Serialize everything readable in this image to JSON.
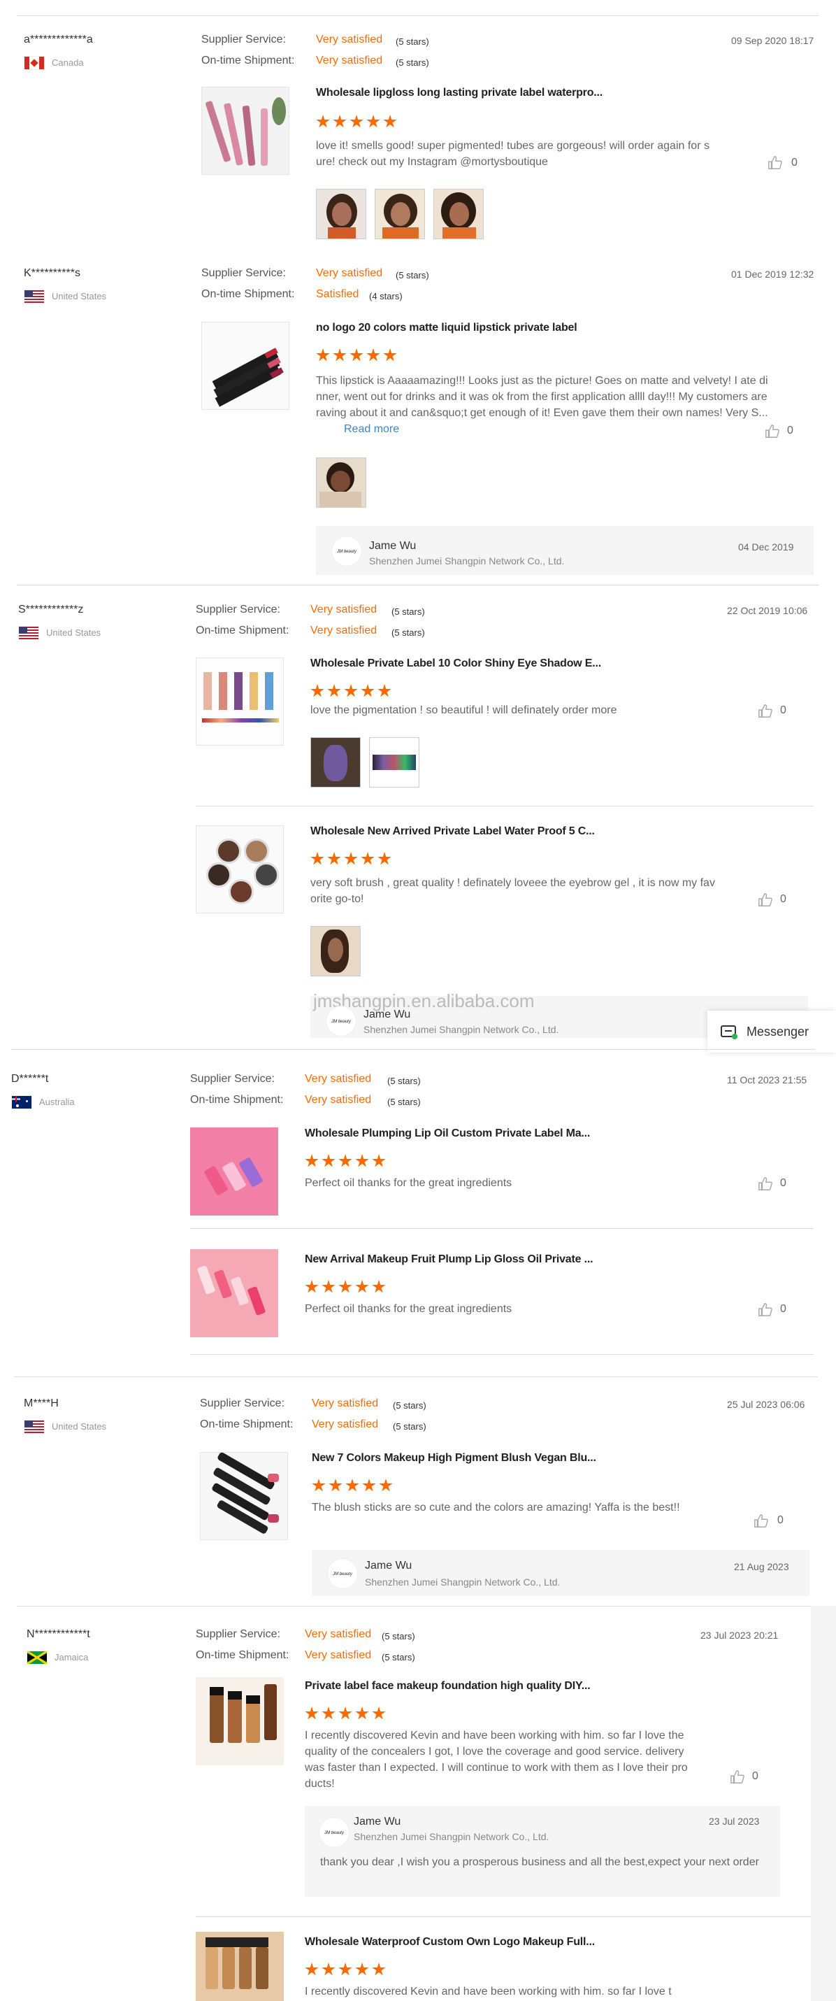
{
  "labels": {
    "supplier_service": "Supplier Service:",
    "on_time_shipment": "On-time Shipment:",
    "read_more": "Read more",
    "messenger": "Messenger",
    "watermark": "jmshangpin.en.alibaba.com"
  },
  "colors": {
    "accent": "#ff6a00",
    "link": "#3d85c6"
  },
  "reviews": [
    {
      "buyer": "a*************a",
      "country": "Canada",
      "flag": "canada",
      "date": "09 Sep 2020 18:17",
      "supplier_service": {
        "rating": "Very satisfied",
        "stars": "(5 stars)"
      },
      "shipment": {
        "rating": "Very satisfied",
        "stars": "(5 stars)"
      },
      "items": [
        {
          "title": "Wholesale lipgloss long lasting private label waterpro...",
          "rating": 5,
          "text": "love it! smells good! super pigmented! tubes are gorgeous! will order again for sure! check out my Instagram @mortysboutique",
          "likes": "0",
          "photos": 3
        }
      ]
    },
    {
      "buyer": "K**********s",
      "country": "United States",
      "flag": "us",
      "date": "01 Dec 2019 12:32",
      "supplier_service": {
        "rating": "Very satisfied",
        "stars": "(5 stars)"
      },
      "shipment": {
        "rating": "Satisfied",
        "stars": "(4 stars)"
      },
      "items": [
        {
          "title": "no logo 20 colors matte liquid lipstick private label",
          "rating": 5,
          "text": "This lipstick is Aaaaamazing!!! Looks just as the picture! Goes on matte and velvety! I ate dinner, went out for drinks and it was ok from the first application allll day!!! My customers are raving about it and can&squo;t get enough of it! Even gave them their own names! Very S...",
          "likes": "0",
          "photos": 1
        }
      ],
      "reply": {
        "name": "Jame Wu",
        "company": "Shenzhen Jumei Shangpin Network Co., Ltd.",
        "date": "04 Dec 2019",
        "text": ""
      }
    },
    {
      "buyer": "S************z",
      "country": "United States",
      "flag": "us",
      "date": "22 Oct 2019 10:06",
      "supplier_service": {
        "rating": "Very satisfied",
        "stars": "(5 stars)"
      },
      "shipment": {
        "rating": "Very satisfied",
        "stars": "(5 stars)"
      },
      "items": [
        {
          "title": "Wholesale Private Label 10 Color Shiny Eye Shadow E...",
          "rating": 5,
          "text": "love the pigmentation ! so beautiful ! will definately order more",
          "likes": "0",
          "photos": 2
        },
        {
          "title": "Wholesale New Arrived Private Label Water Proof 5 C...",
          "rating": 5,
          "text": "very soft brush , great quality ! definately loveee the eyebrow gel , it is now my favorite go-to!",
          "likes": "0",
          "photos": 1
        }
      ],
      "reply": {
        "name": "Jame Wu",
        "company": "Shenzhen Jumei Shangpin Network Co., Ltd.",
        "date": "",
        "text": ""
      }
    },
    {
      "buyer": "D******t",
      "country": "Australia",
      "flag": "australia",
      "date": "11 Oct 2023 21:55",
      "supplier_service": {
        "rating": "Very satisfied",
        "stars": "(5 stars)"
      },
      "shipment": {
        "rating": "Very satisfied",
        "stars": "(5 stars)"
      },
      "items": [
        {
          "title": "Wholesale Plumping Lip Oil Custom Private Label Ma...",
          "rating": 5,
          "text": "Perfect oil thanks for the great ingredients",
          "likes": "0",
          "photos": 0
        },
        {
          "title": "New Arrival Makeup Fruit Plump Lip Gloss Oil Private ...",
          "rating": 5,
          "text": "Perfect oil thanks for the great ingredients",
          "likes": "0",
          "photos": 0
        }
      ]
    },
    {
      "buyer": "M****H",
      "country": "United States",
      "flag": "us",
      "date": "25 Jul 2023 06:06",
      "supplier_service": {
        "rating": "Very satisfied",
        "stars": "(5 stars)"
      },
      "shipment": {
        "rating": "Very satisfied",
        "stars": "(5 stars)"
      },
      "items": [
        {
          "title": "New 7 Colors Makeup High Pigment Blush Vegan Blu...",
          "rating": 5,
          "text": "The blush sticks are so cute and the colors are amazing! Yaffa is the best!!",
          "likes": "0",
          "photos": 0
        }
      ],
      "reply": {
        "name": "Jame Wu",
        "company": "Shenzhen Jumei Shangpin Network Co., Ltd.",
        "date": "21 Aug 2023",
        "text": ""
      }
    },
    {
      "buyer": "N************t",
      "country": "Jamaica",
      "flag": "jamaica",
      "date": "23 Jul 2023 20:21",
      "supplier_service": {
        "rating": "Very satisfied",
        "stars": "(5 stars)"
      },
      "shipment": {
        "rating": "Very satisfied",
        "stars": "(5 stars)"
      },
      "items": [
        {
          "title": "Private label face makeup foundation high quality DIY...",
          "rating": 5,
          "text": "I recently discovered Kevin and have been working with him. so far I love the quality of the concealers I got, I love the coverage and good service. delivery was faster than I expected. I will continue to work with them as I love their products!",
          "likes": "0",
          "photos": 0
        },
        {
          "title": "Wholesale Waterproof Custom Own Logo Makeup Full...",
          "rating": 5,
          "text": "I recently discovered Kevin and have been working with him. so far I love t",
          "likes": "",
          "photos": 0
        }
      ],
      "reply": {
        "name": "Jame Wu",
        "company": "Shenzhen Jumei Shangpin Network Co., Ltd.",
        "date": "23 Jul 2023",
        "text": "thank you dear ,I wish you a prosperous business and all the best,expect your next order"
      }
    }
  ]
}
